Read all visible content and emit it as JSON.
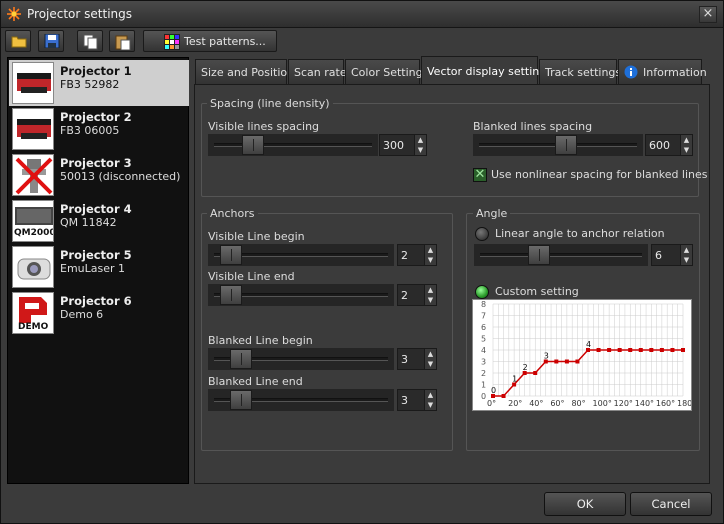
{
  "window": {
    "title": "Projector settings",
    "close_glyph": "×"
  },
  "toolbar": {
    "buttons": [
      "open-folder-icon",
      "save-icon",
      "copy-icon",
      "paste-icon"
    ],
    "test_patterns_label": "Test patterns..."
  },
  "projectors": [
    {
      "name": "Projector 1",
      "sub": "FB3 52982",
      "selected": true
    },
    {
      "name": "Projector 2",
      "sub": "FB3 06005",
      "selected": false
    },
    {
      "name": "Projector 3",
      "sub": "50013 (disconnected)",
      "selected": false
    },
    {
      "name": "Projector 4",
      "sub": "QM 11842",
      "selected": false,
      "thumb_text": "QM2000"
    },
    {
      "name": "Projector 5",
      "sub": "EmuLaser 1",
      "selected": false
    },
    {
      "name": "Projector 6",
      "sub": "Demo 6",
      "selected": false,
      "thumb_text": "DEMO"
    }
  ],
  "tabs": [
    {
      "label": "Size and Position",
      "active": false
    },
    {
      "label": "Scan rate",
      "active": false
    },
    {
      "label": "Color Settings",
      "active": false
    },
    {
      "label": "Vector display settings",
      "active": true
    },
    {
      "label": "Track settings",
      "active": false
    },
    {
      "label": "Information",
      "active": false
    }
  ],
  "spacing": {
    "group_label": "Spacing (line density)",
    "visible_label": "Visible lines spacing",
    "visible_value": "300",
    "blanked_label": "Blanked lines spacing",
    "blanked_value": "600",
    "nonlinear_label": "Use nonlinear spacing for blanked lines",
    "nonlinear_checked": true
  },
  "anchors": {
    "group_label": "Anchors",
    "visible_begin_label": "Visible Line begin",
    "visible_begin_value": "2",
    "visible_end_label": "Visible Line end",
    "visible_end_value": "2",
    "blanked_begin_label": "Blanked Line begin",
    "blanked_begin_value": "3",
    "blanked_end_label": "Blanked Line end",
    "blanked_end_value": "3"
  },
  "angle": {
    "group_label": "Angle",
    "linear_label": "Linear angle to anchor relation",
    "linear_value": "6",
    "custom_label": "Custom setting",
    "selected_option": "custom"
  },
  "chart_data": {
    "type": "line",
    "x_tick_labels": [
      "0°",
      "20°",
      "40°",
      "60°",
      "80°",
      "100°",
      "120°",
      "140°",
      "160°",
      "180°"
    ],
    "y_tick_labels": [
      "0",
      "1",
      "2",
      "3",
      "4",
      "5",
      "6",
      "7",
      "8"
    ],
    "ylim": [
      0,
      8
    ],
    "xlim": [
      0,
      180
    ],
    "grid": true,
    "x": [
      0,
      10,
      20,
      30,
      40,
      50,
      60,
      70,
      80,
      90,
      100,
      110,
      120,
      130,
      140,
      150,
      160,
      170,
      180
    ],
    "values": [
      0,
      0,
      1,
      2,
      2,
      3,
      3,
      3,
      3,
      4,
      4,
      4,
      4,
      4,
      4,
      4,
      4,
      4,
      4
    ],
    "point_labels": [
      {
        "x": 0,
        "y": 0,
        "label": "0"
      },
      {
        "x": 20,
        "y": 1,
        "label": "1"
      },
      {
        "x": 30,
        "y": 2,
        "label": "2"
      },
      {
        "x": 50,
        "y": 3,
        "label": "3"
      },
      {
        "x": 90,
        "y": 4,
        "label": "4"
      }
    ],
    "line_color": "#cc0000"
  },
  "footer": {
    "ok_label": "OK",
    "cancel_label": "Cancel"
  }
}
